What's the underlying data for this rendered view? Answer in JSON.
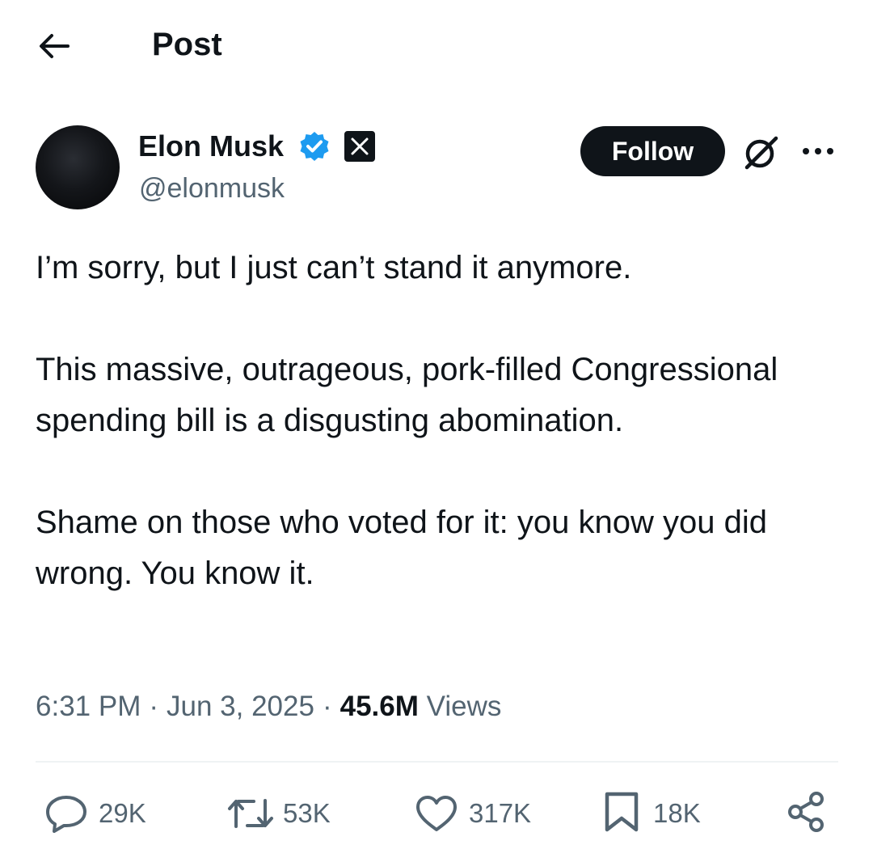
{
  "header": {
    "back_icon": "arrow-left-icon",
    "title": "Post"
  },
  "author": {
    "avatar_icon": "avatar",
    "name": "Elon Musk",
    "verified_icon": "verified-badge-icon",
    "affiliation_icon": "x-logo-icon",
    "handle": "@elonmusk",
    "follow_label": "Follow"
  },
  "post_actions": {
    "grok_icon": "grok-icon",
    "more_icon": "more-horizontal-icon"
  },
  "post": {
    "paragraph_1": "I’m sorry, but I just can’t stand it anymore.",
    "paragraph_2": "This massive, outrageous, pork-filled Congressional spending bill is a disgusting abomination.",
    "paragraph_3": "Shame on those who voted for it: you know you did wrong. You know it."
  },
  "meta": {
    "time": "6:31 PM",
    "date": "Jun 3, 2025",
    "views_count": "45.6M",
    "views_label": "Views"
  },
  "actions": {
    "replies": "29K",
    "reposts": "53K",
    "likes": "317K",
    "bookmarks": "18K"
  },
  "colors": {
    "text_primary": "#0f1419",
    "text_secondary": "#536471",
    "verified_blue": "#1d9bf0",
    "divider": "#eff3f4"
  }
}
